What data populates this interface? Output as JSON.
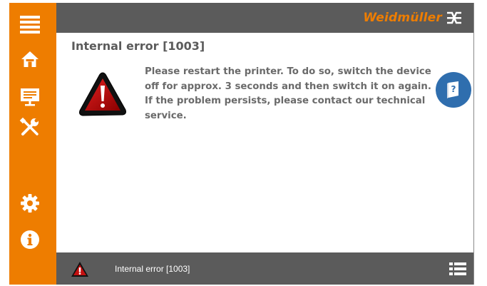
{
  "brand": {
    "name": "Weidmüller",
    "accent": "#ee7d00"
  },
  "sidebar": {
    "items": [
      {
        "icon": "menu-icon"
      },
      {
        "icon": "home-icon"
      },
      {
        "icon": "presentation-icon"
      },
      {
        "icon": "tools-icon"
      },
      {
        "icon": "gear-icon"
      },
      {
        "icon": "info-icon"
      }
    ]
  },
  "main": {
    "title": "Internal error [1003]",
    "message": "Please restart the printer. To do so, switch the device off for approx. 3 seconds and then switch it on again. If the problem persists, please contact our technical service.",
    "help_icon": "help-book-icon"
  },
  "status": {
    "text": "Internal error [1003]",
    "icon": "warning-icon",
    "list_icon": "list-icon"
  }
}
